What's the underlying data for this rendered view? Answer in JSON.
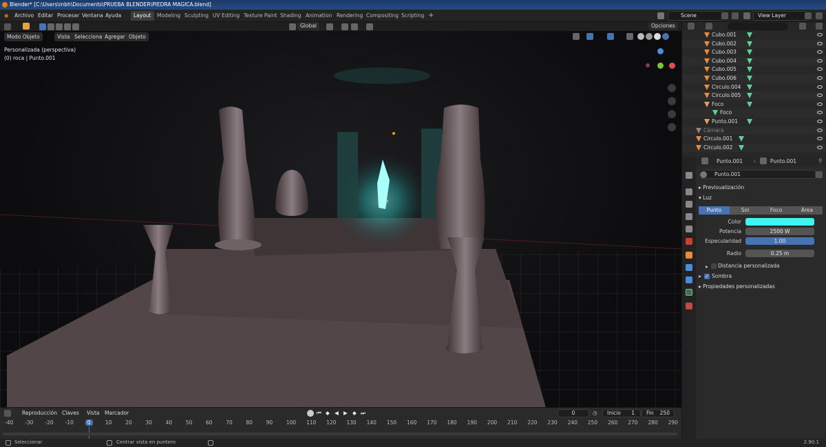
{
  "window": {
    "title": "Blender* [C:\\Users\\mbh\\Documents\\PRUEBA BLENDER\\PIEDRA MAGICA.blend]"
  },
  "menu": [
    "Archivo",
    "Editar",
    "Procesar",
    "Ventana",
    "Ayuda"
  ],
  "workspaces": [
    "Layout",
    "Modeling",
    "Sculpting",
    "UV Editing",
    "Texture Paint",
    "Shading",
    "Animation",
    "Rendering",
    "Compositing",
    "Scripting"
  ],
  "active_workspace": "Layout",
  "scene": {
    "name": "Scene",
    "view_layer": "View Layer"
  },
  "viewport": {
    "mode": "Modo Objeto",
    "menus": [
      "Vista",
      "Seleccionar",
      "Agregar",
      "Objeto"
    ],
    "transform_orientation": "Global",
    "options_label": "Opciones",
    "view_name": "Personalizada (perspectiva)",
    "selection_info": "(0) roca | Punto.001"
  },
  "timeline": {
    "menus": [
      "Reproducción",
      "Claves",
      "Vista",
      "Marcador"
    ],
    "current_frame": "0",
    "start_label": "Inicio",
    "start": "1",
    "end_label": "Fin",
    "end": "250",
    "ruler": [
      "-40",
      "-30",
      "-20",
      "-10",
      "0",
      "10",
      "20",
      "30",
      "40",
      "50",
      "60",
      "70",
      "80",
      "90",
      "100",
      "110",
      "120",
      "130",
      "140",
      "150",
      "160",
      "170",
      "180",
      "190",
      "200",
      "210",
      "220",
      "230",
      "240",
      "250",
      "260",
      "270",
      "280",
      "290"
    ]
  },
  "status": {
    "select": "Seleccionar",
    "center": "Centrar vista en puntero",
    "version": "2.90.1"
  },
  "outliner": {
    "rows": [
      {
        "label": "Cubo.001",
        "type": "object"
      },
      {
        "label": "Cubo.002",
        "type": "object"
      },
      {
        "label": "Cubo.003",
        "type": "object"
      },
      {
        "label": "Cubo.004",
        "type": "object"
      },
      {
        "label": "Cubo.005",
        "type": "object"
      },
      {
        "label": "Cubo.006",
        "type": "object"
      },
      {
        "label": "Circulo.004",
        "type": "object"
      },
      {
        "label": "Circulo.005",
        "type": "object"
      },
      {
        "label": "Foco",
        "type": "light"
      },
      {
        "label": "Foco",
        "type": "light-data"
      },
      {
        "label": "Punto.001",
        "type": "light"
      },
      {
        "label": "Cámara",
        "type": "camera"
      },
      {
        "label": "Circulo.001",
        "type": "object"
      },
      {
        "label": "Circulo.002",
        "type": "object"
      }
    ]
  },
  "properties": {
    "breadcrumb_object": "Punto.001",
    "breadcrumb_data": "Punto.001",
    "datablock": "Punto.001",
    "panels": {
      "preview": "Previsualización",
      "light": "Luz",
      "shadow": "Sombra",
      "custom": "Propiedades personalizadas",
      "custom_distance": "Distancia personalizada"
    },
    "light_types": [
      "Punto",
      "Sol",
      "Foco",
      "Área"
    ],
    "active_light_type": "Punto",
    "color_label": "Color",
    "color_value": "#3ff5f0",
    "power_label": "Potencia",
    "power": "2500 W",
    "specular_label": "Especularidad",
    "specular": "1.00",
    "radius_label": "Radio",
    "radius": "0.25 m"
  },
  "colors": {
    "accent": "#4772b3",
    "object_icon": "#e88c3e",
    "data_icon": "#5fcf9a",
    "light_glow": "#3ff5f0"
  }
}
